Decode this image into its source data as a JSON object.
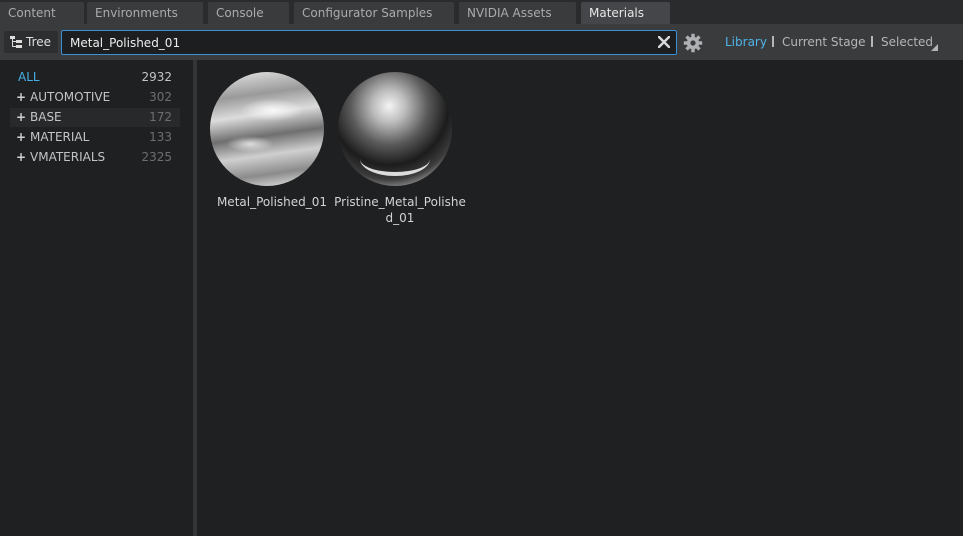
{
  "tabs": [
    {
      "label": "Content"
    },
    {
      "label": "Environments"
    },
    {
      "label": "Console"
    },
    {
      "label": "Configurator Samples"
    },
    {
      "label": "NVIDIA Assets"
    },
    {
      "label": "Materials"
    }
  ],
  "active_tab": "Materials",
  "toolbar": {
    "tree_label": "Tree",
    "search_value": "Metal_Polished_01",
    "filters": [
      "Library",
      "Current Stage",
      "Selected"
    ],
    "active_filter": "Library"
  },
  "tree": [
    {
      "label": "ALL",
      "count": "2932",
      "expandable": false
    },
    {
      "label": "AUTOMOTIVE",
      "count": "302",
      "expandable": true
    },
    {
      "label": "BASE",
      "count": "172",
      "expandable": true
    },
    {
      "label": "MATERIAL",
      "count": "133",
      "expandable": true
    },
    {
      "label": "VMATERIALS",
      "count": "2325",
      "expandable": true
    }
  ],
  "materials": [
    {
      "name": "Metal_Polished_01"
    },
    {
      "name": "Pristine_Metal_Polished_01"
    }
  ],
  "colors": {
    "accent": "#46aee8",
    "search_border": "#3b8fd6",
    "background": "#1f2021"
  }
}
